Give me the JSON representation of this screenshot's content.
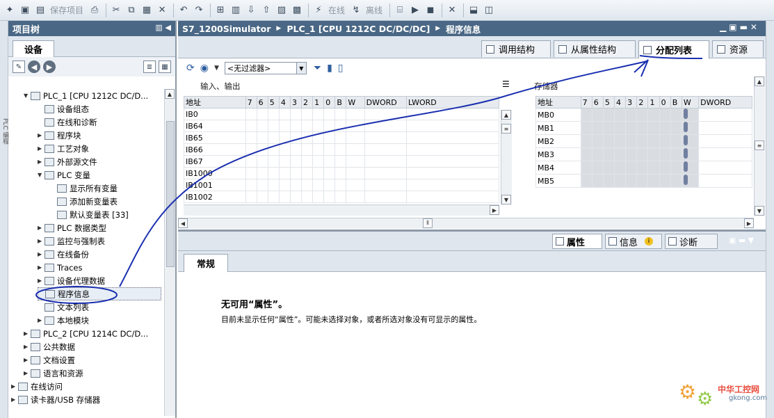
{
  "toolbar": {
    "save_project": "保存项目",
    "online": "在线",
    "offline": "离线"
  },
  "left": {
    "title": "项目树",
    "side_label": "PLC 编程",
    "tab": "设备",
    "tree": [
      {
        "label": "PLC_1 [CPU 1212C DC/D...",
        "arrow": "▼"
      },
      {
        "label": "设备组态",
        "arrow": ""
      },
      {
        "label": "在线和诊断",
        "arrow": ""
      },
      {
        "label": "程序块",
        "arrow": "▶"
      },
      {
        "label": "工艺对象",
        "arrow": "▶"
      },
      {
        "label": "外部源文件",
        "arrow": "▶"
      },
      {
        "label": "PLC 变量",
        "arrow": "▼"
      },
      {
        "label": "显示所有变量",
        "arrow": ""
      },
      {
        "label": "添加新变量表",
        "arrow": ""
      },
      {
        "label": "默认变量表 [33]",
        "arrow": ""
      },
      {
        "label": "PLC 数据类型",
        "arrow": "▶"
      },
      {
        "label": "监控与强制表",
        "arrow": "▶"
      },
      {
        "label": "在线备份",
        "arrow": "▶"
      },
      {
        "label": "Traces",
        "arrow": "▶"
      },
      {
        "label": "设备代理数据",
        "arrow": "▶"
      },
      {
        "label": "程序信息",
        "arrow": ""
      },
      {
        "label": "文本列表",
        "arrow": ""
      },
      {
        "label": "本地模块",
        "arrow": "▶"
      },
      {
        "label": "PLC_2 [CPU 1214C DC/D...",
        "arrow": "▶"
      },
      {
        "label": "公共数据",
        "arrow": "▶"
      },
      {
        "label": "文档设置",
        "arrow": "▶"
      },
      {
        "label": "语言和资源",
        "arrow": "▶"
      },
      {
        "label": "在线访问",
        "arrow": "▶"
      },
      {
        "label": "读卡器/USB 存储器",
        "arrow": "▶"
      }
    ]
  },
  "right": {
    "breadcrumb": [
      "S7_1200Simulator",
      "PLC_1 [CPU 1212C DC/DC/DC]",
      "程序信息"
    ],
    "tabs": [
      "调用结构",
      "从属性结构",
      "分配列表",
      "资源"
    ],
    "filter": "<无过滤器>",
    "io_label": "输入、输出",
    "mem_label": "存储器",
    "io_headers": [
      "地址",
      "7",
      "6",
      "5",
      "4",
      "3",
      "2",
      "1",
      "0",
      "B",
      "W",
      "DWORD",
      "LWORD"
    ],
    "io_rows": [
      "IB0",
      "IB64",
      "IB65",
      "IB66",
      "IB67",
      "IB1000",
      "IB1001",
      "IB1002"
    ],
    "mem_headers": [
      "地址",
      "7",
      "6",
      "5",
      "4",
      "3",
      "2",
      "1",
      "0",
      "B",
      "W",
      "DWORD"
    ],
    "mem_rows": [
      "MB0",
      "MB1",
      "MB2",
      "MB3",
      "MB4",
      "MB5"
    ]
  },
  "inspector": {
    "tabs": [
      "属性",
      "信息",
      "诊断"
    ],
    "general_tab": "常规",
    "msg_title": "无可用“属性”。",
    "msg_body": "目前未显示任何“属性”。可能未选择对象，或者所选对象没有可显示的属性。"
  },
  "watermark": {
    "brand": "中华工控网",
    "site": "gkong.com"
  }
}
